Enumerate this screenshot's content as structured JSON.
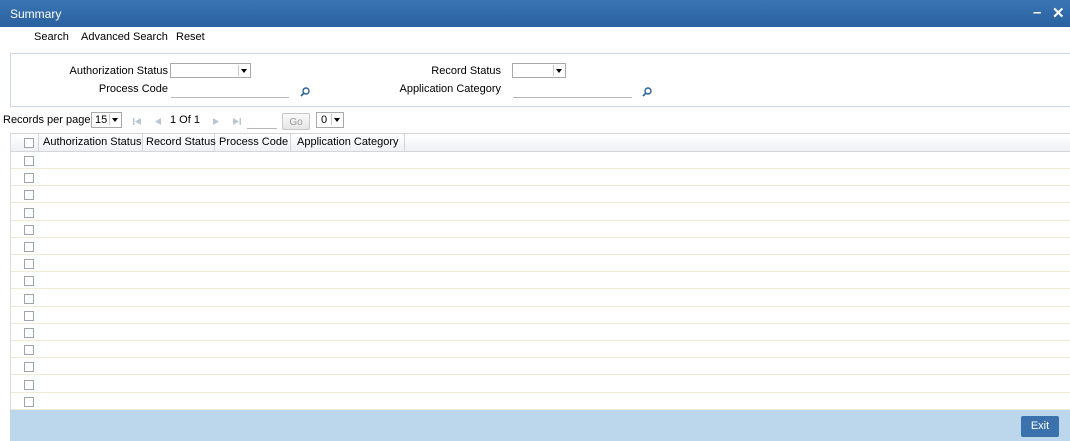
{
  "window": {
    "title": "Summary"
  },
  "toolbar": {
    "search": "Search",
    "advanced_search": "Advanced Search",
    "reset": "Reset"
  },
  "search_form": {
    "authorization_status_label": "Authorization Status",
    "authorization_status_value": "",
    "record_status_label": "Record Status",
    "record_status_value": "",
    "process_code_label": "Process Code",
    "process_code_value": "",
    "application_category_label": "Application Category",
    "application_category_value": ""
  },
  "pager": {
    "records_per_page_label": "Records per page",
    "records_per_page_value": "15",
    "page_info": "1 Of 1",
    "go_label": "Go",
    "jump_value": "0"
  },
  "grid": {
    "columns": [
      "Authorization Status",
      "Record Status",
      "Process Code",
      "Application Category"
    ],
    "row_count": 15
  },
  "footer": {
    "exit_label": "Exit"
  },
  "colors": {
    "title_bar": "#2f68a8",
    "footer": "#bcd6ec",
    "exit_button": "#3b72ad",
    "lookup_icon": "#2a5f9e"
  }
}
